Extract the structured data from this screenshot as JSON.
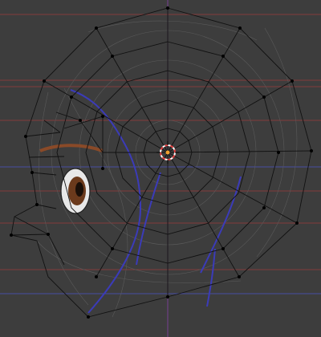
{
  "viewport": {
    "background_color": "#3d3d3d",
    "wire_color": "#111111",
    "grid_red": "#8b3a3a",
    "grid_blue": "#4a4fb0",
    "curve_blue": "#3b3bb8",
    "cursor_icon": "3d-cursor-icon"
  }
}
